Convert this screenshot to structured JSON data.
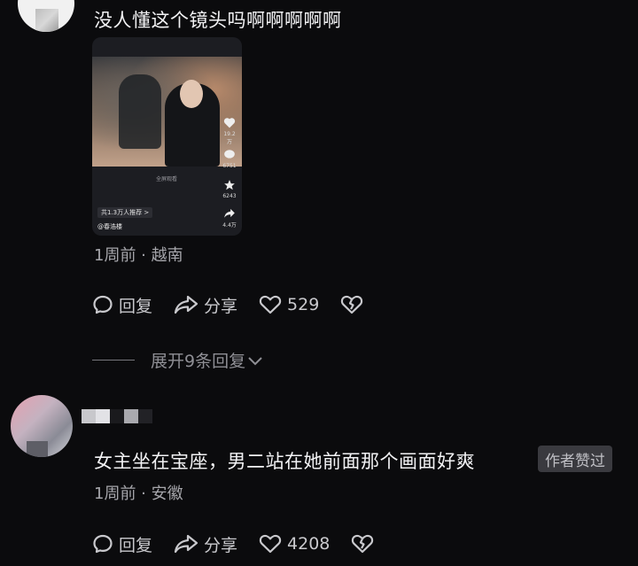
{
  "comments": [
    {
      "text": "没人懂这个镜头吗啊啊啊啊啊",
      "thumbnail": {
        "likes": "19.2万",
        "comments": "6751",
        "stars": "6243",
        "shares": "4.4万",
        "center_caption": "全屏观看",
        "tag": "共1.3万人推荐 >",
        "author": "@春浩楼"
      },
      "meta": "1周前 · 越南",
      "reply_label": "回复",
      "share_label": "分享",
      "like_count": "529",
      "expand_label": "展开9条回复"
    },
    {
      "text": "女主坐在宝座，男二站在她前面那个画面好爽",
      "badge": "作者赞过",
      "meta": "1周前 · 安徽",
      "reply_label": "回复",
      "share_label": "分享",
      "like_count": "4208"
    }
  ],
  "colors": {
    "background": "#0b0b0d",
    "text": "#f2f2f4",
    "muted": "#a6a6ab",
    "badge_bg": "#3a3a3f"
  }
}
